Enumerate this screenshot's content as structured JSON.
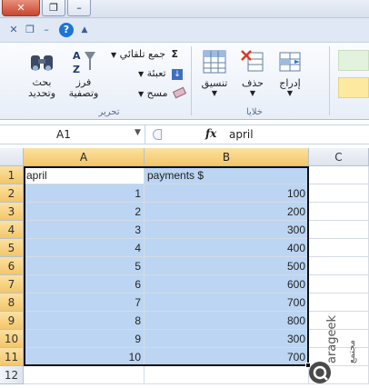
{
  "ribbon": {
    "editing_group": {
      "label": "تحرير",
      "find_select": "بحث وتحديد",
      "sort_filter": "فرز وتصفية",
      "autosum": "جمع تلقائي",
      "fill": "تعبئة",
      "clear": "مسح"
    },
    "cells_group": {
      "label": "خلايا",
      "format": "تنسيق",
      "delete": "حذف",
      "insert": "إدراج"
    }
  },
  "formula_bar": {
    "name_box": "A1",
    "fx_label": "fx",
    "content": "april"
  },
  "grid": {
    "columns": [
      "A",
      "B",
      "C"
    ],
    "rows": [
      {
        "num": "1",
        "a": "april",
        "b": "payments $"
      },
      {
        "num": "2",
        "a": "1",
        "b": "100"
      },
      {
        "num": "3",
        "a": "2",
        "b": "200"
      },
      {
        "num": "4",
        "a": "3",
        "b": "300"
      },
      {
        "num": "5",
        "a": "4",
        "b": "400"
      },
      {
        "num": "6",
        "a": "5",
        "b": "500"
      },
      {
        "num": "7",
        "a": "6",
        "b": "600"
      },
      {
        "num": "8",
        "a": "7",
        "b": "700"
      },
      {
        "num": "9",
        "a": "8",
        "b": "800"
      },
      {
        "num": "10",
        "a": "9",
        "b": "300"
      },
      {
        "num": "11",
        "a": "10",
        "b": "700"
      },
      {
        "num": "12",
        "a": "",
        "b": ""
      }
    ]
  },
  "watermark": {
    "line1": "arageek",
    "line2": "مجتمع"
  },
  "colors": {
    "selection": "#bcd5f2",
    "header_selected": "#f3c669",
    "close_button": "#c8452e"
  }
}
